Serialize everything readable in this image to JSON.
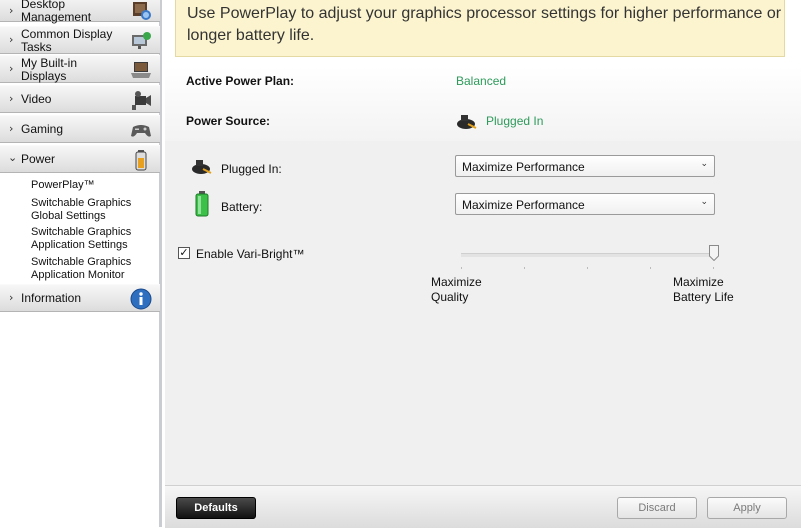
{
  "sidebar": {
    "items": [
      {
        "label_line1": "Desktop",
        "label_line2": "Management",
        "icon": "desktop-management-icon"
      },
      {
        "label_line1": "Common Display",
        "label_line2": "Tasks",
        "icon": "display-tasks-icon"
      },
      {
        "label_line1": "My Built-in",
        "label_line2": "Displays",
        "icon": "laptop-icon"
      },
      {
        "label": "Video",
        "icon": "video-camera-icon"
      },
      {
        "label": "Gaming",
        "icon": "gamepad-icon"
      },
      {
        "label": "Power",
        "icon": "battery-icon",
        "expanded": true
      },
      {
        "label": "Information",
        "icon": "info-icon"
      }
    ],
    "subitems": [
      {
        "label": "PowerPlay™"
      },
      {
        "label_line1": "Switchable Graphics",
        "label_line2": "Global Settings"
      },
      {
        "label_line1": "Switchable Graphics",
        "label_line2": "Application Settings"
      },
      {
        "label_line1": "Switchable Graphics",
        "label_line2": "Application Monitor"
      }
    ]
  },
  "banner": {
    "text": "Use PowerPlay to adjust your graphics processor settings for higher performance or longer battery life."
  },
  "info": {
    "plan_label": "Active Power Plan:",
    "plan_value": "Balanced",
    "source_label": "Power Source:",
    "source_value": "Plugged In"
  },
  "settings": {
    "plugged_label": "Plugged In:",
    "plugged_value": "Maximize Performance",
    "battery_label": "Battery:",
    "battery_value": "Maximize Performance",
    "varibright_label": "Enable Vari-Bright™",
    "varibright_checked": true,
    "slider_level": 1.0,
    "slider_left_line1": "Maximize",
    "slider_left_line2": "Quality",
    "slider_right_line1": "Maximize",
    "slider_right_line2": "Battery Life"
  },
  "footer": {
    "defaults_label": "Defaults",
    "discard_label": "Discard",
    "apply_label": "Apply"
  },
  "colors": {
    "accent_green": "#2e9a5b",
    "banner_bg": "#fbf4cf"
  }
}
